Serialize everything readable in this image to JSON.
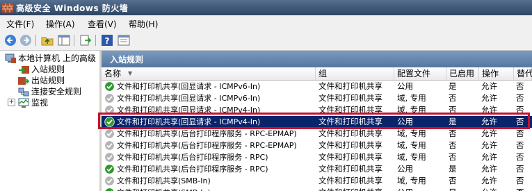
{
  "window": {
    "title": "高级安全 Windows 防火墙"
  },
  "menu": [
    "文件(F)",
    "操作(A)",
    "查看(V)",
    "帮助(H)"
  ],
  "toolbar": {
    "buttons": [
      "back-arrow-icon",
      "forward-arrow-icon",
      "up-folder-icon",
      "show-hide-tree-icon",
      "export-list-icon",
      "help-icon",
      "properties-icon"
    ]
  },
  "tree": {
    "root": "本地计算机 上的高级",
    "items": [
      "入站规则",
      "出站规则",
      "连接安全规则",
      "监视"
    ]
  },
  "pane": {
    "title": "入站规则",
    "columns": [
      "名称",
      "组",
      "配置文件",
      "已启用",
      "操作",
      "替代"
    ]
  },
  "rules": [
    {
      "name": "文件和打印机共享(回显请求 - ICMPv6-In)",
      "group": "文件和打印机共享",
      "profile": "公用",
      "enabled": "是",
      "action": "允许",
      "override": "否",
      "status": "enabled"
    },
    {
      "name": "文件和打印机共享(回显请求 - ICMPv6-In)",
      "group": "文件和打印机共享",
      "profile": "域, 专用",
      "enabled": "否",
      "action": "允许",
      "override": "否",
      "status": "disabled"
    },
    {
      "name": "文件和打印机共享(回显请求 - ICMPv4-In)",
      "group": "文件和打印机共享",
      "profile": "域, 专用",
      "enabled": "否",
      "action": "允许",
      "override": "否",
      "status": "disabled"
    },
    {
      "name": "文件和打印机共享(回显请求 - ICMPv4-In)",
      "group": "文件和打印机共享",
      "profile": "公用",
      "enabled": "是",
      "action": "允许",
      "override": "否",
      "status": "enabled",
      "selected": true
    },
    {
      "name": "文件和打印机共享(后台打印程序服务 - RPC-EPMAP)",
      "group": "文件和打印机共享",
      "profile": "域, 专用",
      "enabled": "否",
      "action": "允许",
      "override": "否",
      "status": "disabled"
    },
    {
      "name": "文件和打印机共享(后台打印程序服务 - RPC-EPMAP)",
      "group": "文件和打印机共享",
      "profile": "域, 专用",
      "enabled": "否",
      "action": "允许",
      "override": "否",
      "status": "disabled"
    },
    {
      "name": "文件和打印机共享(后台打印程序服务 - RPC)",
      "group": "文件和打印机共享",
      "profile": "域, 专用",
      "enabled": "否",
      "action": "允许",
      "override": "否",
      "status": "disabled"
    },
    {
      "name": "文件和打印机共享(后台打印程序服务 - RPC)",
      "group": "文件和打印机共享",
      "profile": "公用",
      "enabled": "是",
      "action": "允许",
      "override": "否",
      "status": "enabled"
    },
    {
      "name": "文件和打印机共享(SMB-In)",
      "group": "文件和打印机共享",
      "profile": "域, 专用",
      "enabled": "否",
      "action": "允许",
      "override": "否",
      "status": "disabled"
    },
    {
      "name": "文件和打印机共享(SMB-In)",
      "group": "文件和打印机共享",
      "profile": "公用",
      "enabled": "是",
      "action": "允许",
      "override": "否",
      "status": "enabled"
    }
  ],
  "colors": {
    "enabled_check": "#2e9a2e",
    "disabled_check": "#b4b4b4",
    "selection": "#0a246a",
    "annotation": "#c8102e"
  }
}
